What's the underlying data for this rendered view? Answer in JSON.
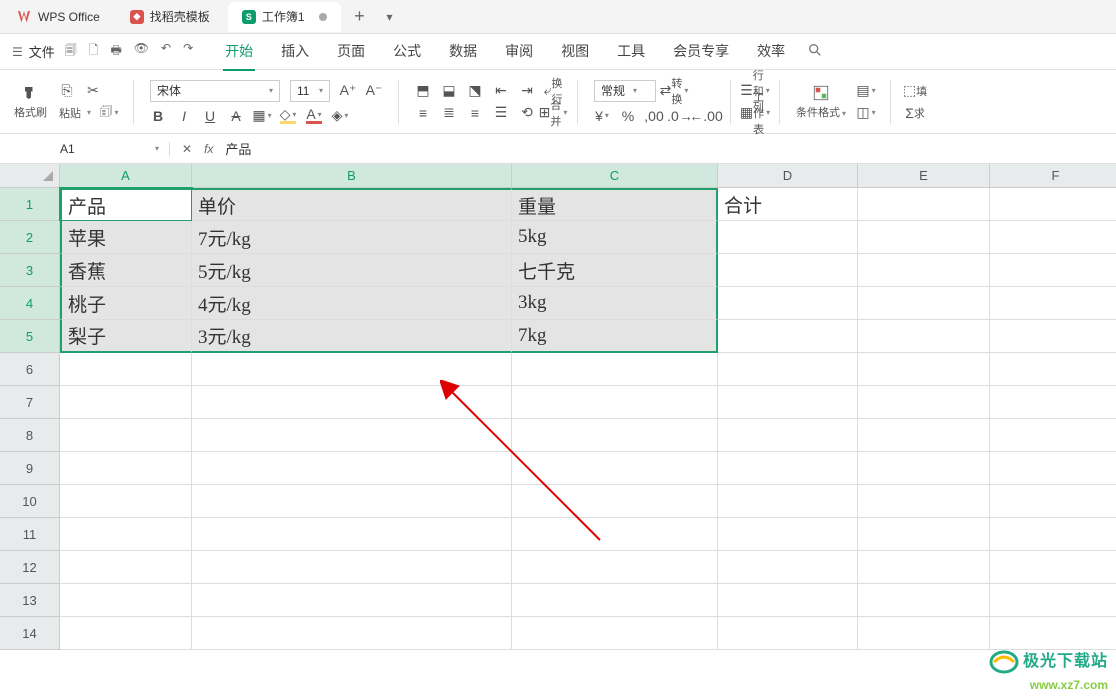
{
  "app": {
    "name": "WPS Office"
  },
  "tabs": [
    {
      "icon_bg": "tab-red",
      "label": "找稻壳模板"
    },
    {
      "icon_bg": "tab-green",
      "icon_text": "S",
      "label": "工作簿1",
      "active": true,
      "dirty": true
    }
  ],
  "menu": {
    "file": "文件",
    "items": [
      "开始",
      "插入",
      "页面",
      "公式",
      "数据",
      "审阅",
      "视图",
      "工具",
      "会员专享",
      "效率"
    ],
    "active_index": 0
  },
  "toolbar": {
    "format_painter": "格式刷",
    "paste": "粘贴",
    "font_name": "宋体",
    "font_size": "11",
    "number_format": "常规",
    "convert": "转换",
    "wrap": "换行",
    "merge": "合并",
    "rows_cols": "行和列",
    "worksheet": "工作表",
    "cond_format": "条件格式",
    "sum": "求",
    "fill_lbl": "填"
  },
  "namebox": "A1",
  "formula": "产品",
  "columns": [
    "A",
    "B",
    "C",
    "D",
    "E",
    "F"
  ],
  "rows": [
    "1",
    "2",
    "3",
    "4",
    "5",
    "6",
    "7",
    "8",
    "9",
    "10",
    "11",
    "12",
    "13",
    "14"
  ],
  "selected_cols": [
    "A",
    "B",
    "C"
  ],
  "selected_rows": [
    "1",
    "2",
    "3",
    "4",
    "5"
  ],
  "chart_data": {
    "type": "table",
    "headers": [
      "产品",
      "单价",
      "重量",
      "合计"
    ],
    "rows": [
      [
        "苹果",
        "7元/kg",
        "5kg",
        ""
      ],
      [
        "香蕉",
        "5元/kg",
        "七千克",
        ""
      ],
      [
        "桃子",
        "4元/kg",
        "3kg",
        ""
      ],
      [
        "梨子",
        "3元/kg",
        "7kg",
        ""
      ]
    ]
  },
  "watermark": {
    "line1": "极光下载站",
    "line2": "www.xz7.com"
  }
}
